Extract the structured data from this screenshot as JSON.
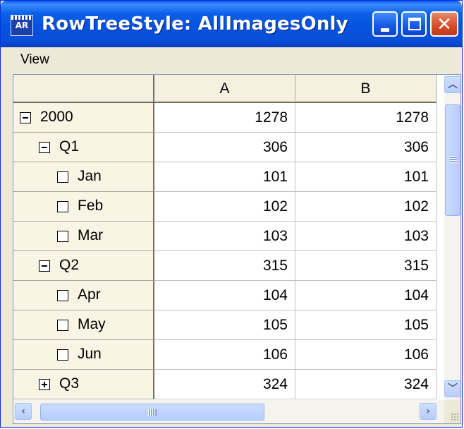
{
  "window": {
    "title": "RowTreeStyle: AllImagesOnly",
    "app_icon": "app-icon",
    "app_icon_text": "AR",
    "controls": [
      "minimize-icon",
      "maximize-icon",
      "close-icon"
    ]
  },
  "menubar": {
    "items": [
      "View"
    ]
  },
  "grid": {
    "columns": [
      "A",
      "B"
    ],
    "rows": [
      {
        "label": "2000",
        "level": 0,
        "icon": "collapse-icon",
        "a": "1278",
        "b": "1278"
      },
      {
        "label": "Q1",
        "level": 1,
        "icon": "collapse-icon",
        "a": "306",
        "b": "306"
      },
      {
        "label": "Jan",
        "level": 2,
        "icon": "leaf-icon",
        "a": "101",
        "b": "101"
      },
      {
        "label": "Feb",
        "level": 2,
        "icon": "leaf-icon",
        "a": "102",
        "b": "102"
      },
      {
        "label": "Mar",
        "level": 2,
        "icon": "leaf-icon",
        "a": "103",
        "b": "103"
      },
      {
        "label": "Q2",
        "level": 1,
        "icon": "collapse-icon",
        "a": "315",
        "b": "315"
      },
      {
        "label": "Apr",
        "level": 2,
        "icon": "leaf-icon",
        "a": "104",
        "b": "104"
      },
      {
        "label": "May",
        "level": 2,
        "icon": "leaf-icon",
        "a": "105",
        "b": "105"
      },
      {
        "label": "Jun",
        "level": 2,
        "icon": "leaf-icon",
        "a": "106",
        "b": "106"
      },
      {
        "label": "Q3",
        "level": 1,
        "icon": "expand-icon",
        "a": "324",
        "b": "324"
      }
    ]
  },
  "colors": {
    "titlebar": "#0a5fe8",
    "header_bg": "#f6f0e0",
    "close_button": "#d64a22"
  }
}
